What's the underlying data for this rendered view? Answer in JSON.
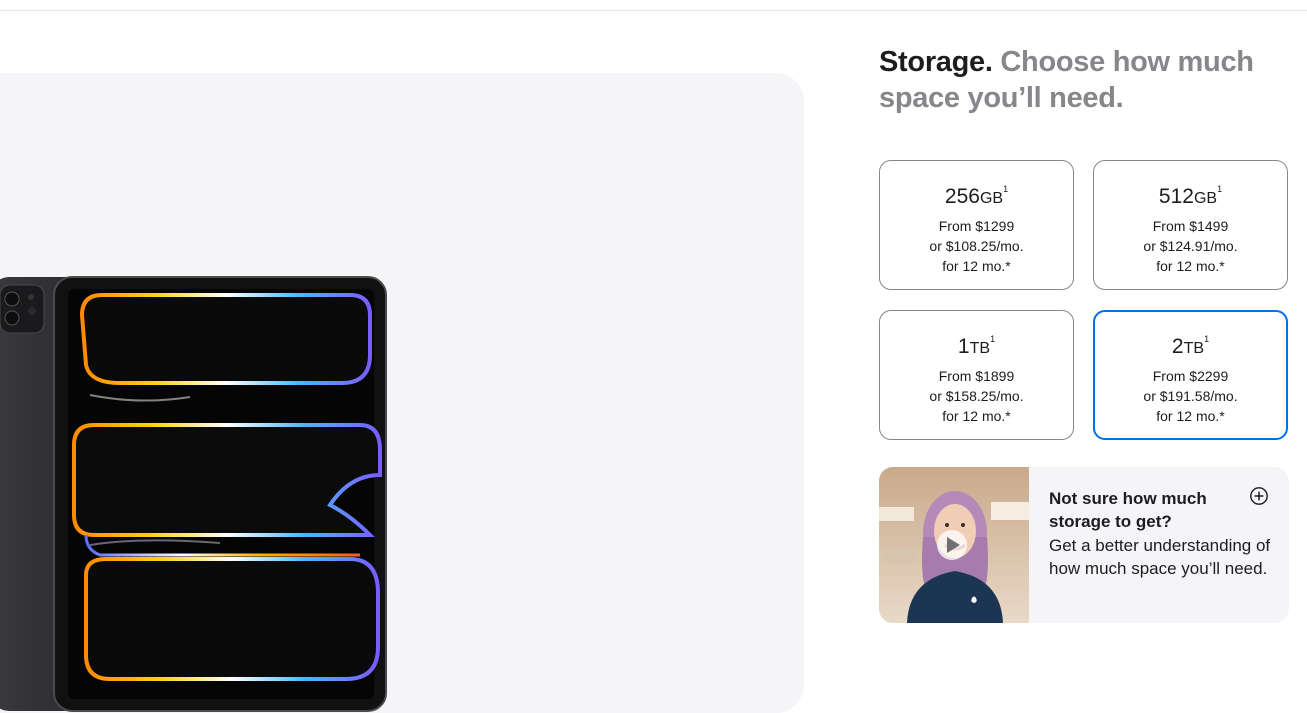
{
  "heading": {
    "strong": "Storage.",
    "muted": "Choose how much space you’ll need."
  },
  "storage_options": [
    {
      "amount": "256",
      "unit": "GB",
      "footnote": "1",
      "price": "From $1299",
      "monthly": "or $108.25/mo.",
      "term": "for 12 mo.*",
      "selected": false
    },
    {
      "amount": "512",
      "unit": "GB",
      "footnote": "1",
      "price": "From $1499",
      "monthly": "or $124.91/mo.",
      "term": "for 12 mo.*",
      "selected": false
    },
    {
      "amount": "1",
      "unit": "TB",
      "footnote": "1",
      "price": "From $1899",
      "monthly": "or $158.25/mo.",
      "term": "for 12 mo.*",
      "selected": false
    },
    {
      "amount": "2",
      "unit": "TB",
      "footnote": "1",
      "price": "From $2299",
      "monthly": "or $191.58/mo.",
      "term": "for 12 mo.*",
      "selected": true
    }
  ],
  "help_card": {
    "title": "Not sure how much storage to get?",
    "description": "Get a better understanding of how much space you’ll need.",
    "expand_icon": "plus-circle-icon",
    "video_icon": "play-icon"
  },
  "colors": {
    "accent": "#0071e3",
    "text": "#1d1d1f",
    "muted": "#86868b",
    "panel": "#f5f5f7"
  }
}
